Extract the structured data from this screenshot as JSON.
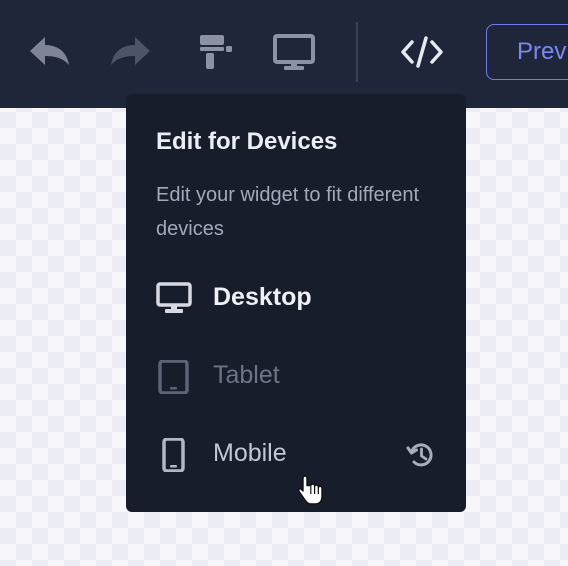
{
  "toolbar": {
    "icons": {
      "undo": "undo-icon",
      "redo": "redo-icon",
      "paint": "paint-roller-icon",
      "desktop": "monitor-icon",
      "code": "code-icon"
    },
    "preview_label": "Prev"
  },
  "popover": {
    "title": "Edit for Devices",
    "description": "Edit your widget to fit different devices",
    "devices": [
      {
        "label": "Desktop",
        "icon": "monitor-icon",
        "state": "active"
      },
      {
        "label": "Tablet",
        "icon": "tablet-icon",
        "state": "disabled"
      },
      {
        "label": "Mobile",
        "icon": "phone-icon",
        "state": "hover"
      }
    ],
    "reset_icon": "history-icon"
  },
  "colors": {
    "toolbar_bg": "#20263a",
    "popover_bg": "#181d2b",
    "accent": "#7b87f5"
  }
}
